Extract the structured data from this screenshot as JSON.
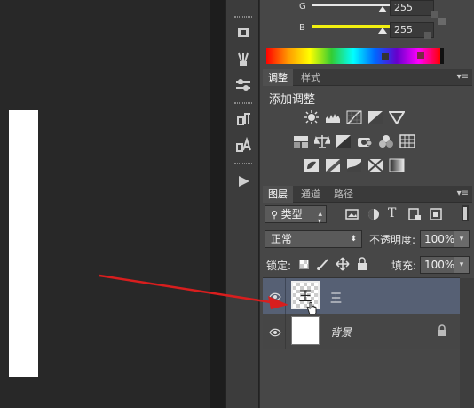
{
  "color_panel": {
    "g_label": "G",
    "g_value": "255",
    "b_label": "B",
    "b_value": "255"
  },
  "adjustments_panel": {
    "tabs": [
      "调整",
      "样式"
    ],
    "title": "添加调整",
    "row1_icons": [
      "brightness-icon",
      "levels-icon",
      "curves-icon",
      "exposure-icon",
      "vibrance-triangle-icon"
    ],
    "row2_icons": [
      "hue-saturation-icon",
      "color-balance-icon",
      "black-white-icon",
      "photo-filter-icon",
      "channel-mixer-icon",
      "color-lookup-icon"
    ],
    "row3_icons": [
      "invert-icon",
      "posterize-icon",
      "threshold-icon",
      "selective-color-icon",
      "gradient-map-icon"
    ]
  },
  "layers_panel": {
    "tabs": [
      "图层",
      "通道",
      "路径"
    ],
    "filter_kind": "类型",
    "blend_mode": "正常",
    "opacity_label": "不透明度:",
    "opacity_value": "100%",
    "lock_label": "锁定:",
    "fill_label": "填充:",
    "fill_value": "100%",
    "layers": [
      {
        "name": "王",
        "selected": true,
        "thumb_text": "王",
        "locked": false
      },
      {
        "name": "背景",
        "selected": false,
        "thumb_text": "",
        "locked": true
      }
    ]
  },
  "colors": {
    "annotation_arrow": "#d81e1e",
    "selected_layer": "#566074",
    "panel_bg": "#474747"
  }
}
